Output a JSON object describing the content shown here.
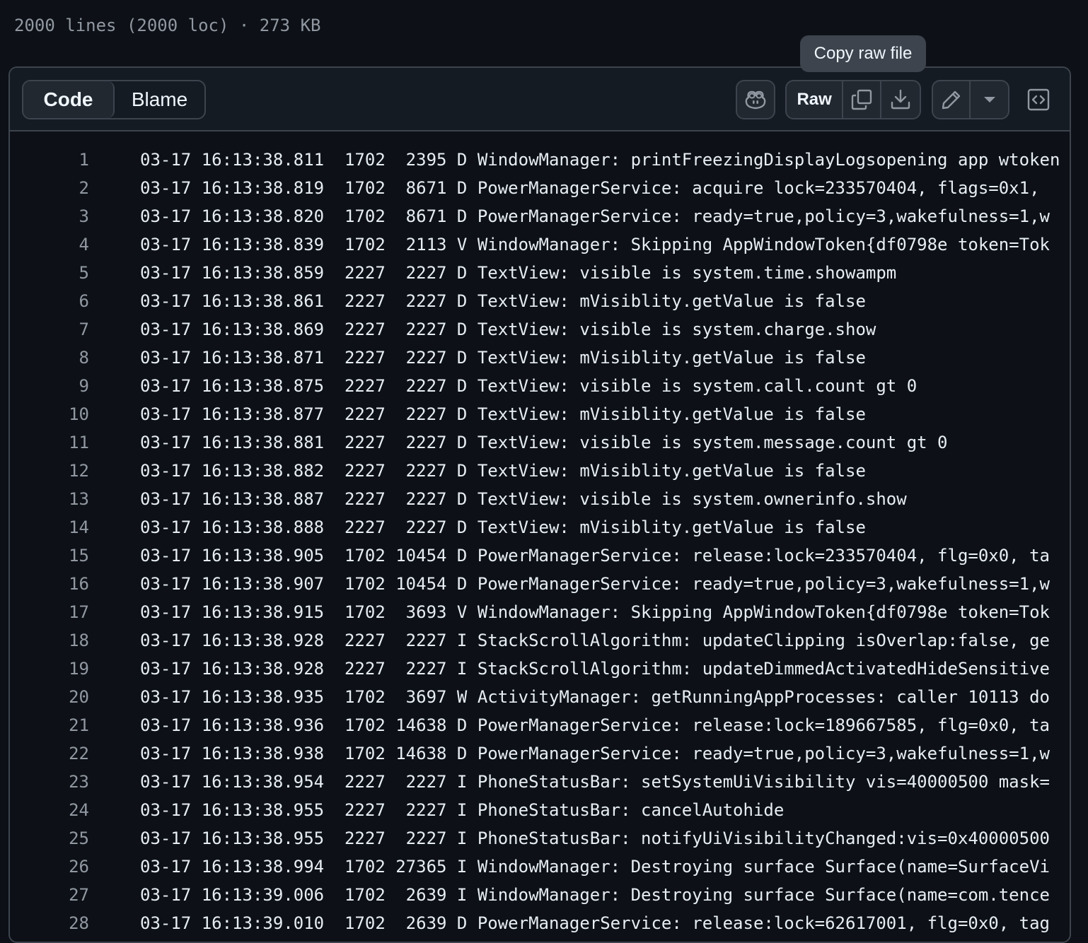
{
  "file_info": "2000 lines (2000 loc) · 273 KB",
  "tooltip": "Copy raw file",
  "toolbar": {
    "tabs": [
      {
        "label": "Code",
        "active": true
      },
      {
        "label": "Blame",
        "active": false
      }
    ],
    "raw_label": "Raw",
    "icons": [
      "copilot-icon",
      "copy-icon",
      "download-icon",
      "pencil-icon",
      "triangle-down-icon",
      "code-square-icon"
    ]
  },
  "lines": [
    {
      "n": "1",
      "t": "03-17 16:13:38.811  1702  2395 D WindowManager: printFreezingDisplayLogsopening app wtoken"
    },
    {
      "n": "2",
      "t": "03-17 16:13:38.819  1702  8671 D PowerManagerService: acquire lock=233570404, flags=0x1, "
    },
    {
      "n": "3",
      "t": "03-17 16:13:38.820  1702  8671 D PowerManagerService: ready=true,policy=3,wakefulness=1,w"
    },
    {
      "n": "4",
      "t": "03-17 16:13:38.839  1702  2113 V WindowManager: Skipping AppWindowToken{df0798e token=Tok"
    },
    {
      "n": "5",
      "t": "03-17 16:13:38.859  2227  2227 D TextView: visible is system.time.showampm"
    },
    {
      "n": "6",
      "t": "03-17 16:13:38.861  2227  2227 D TextView: mVisiblity.getValue is false"
    },
    {
      "n": "7",
      "t": "03-17 16:13:38.869  2227  2227 D TextView: visible is system.charge.show"
    },
    {
      "n": "8",
      "t": "03-17 16:13:38.871  2227  2227 D TextView: mVisiblity.getValue is false"
    },
    {
      "n": "9",
      "t": "03-17 16:13:38.875  2227  2227 D TextView: visible is system.call.count gt 0"
    },
    {
      "n": "10",
      "t": "03-17 16:13:38.877  2227  2227 D TextView: mVisiblity.getValue is false"
    },
    {
      "n": "11",
      "t": "03-17 16:13:38.881  2227  2227 D TextView: visible is system.message.count gt 0"
    },
    {
      "n": "12",
      "t": "03-17 16:13:38.882  2227  2227 D TextView: mVisiblity.getValue is false"
    },
    {
      "n": "13",
      "t": "03-17 16:13:38.887  2227  2227 D TextView: visible is system.ownerinfo.show"
    },
    {
      "n": "14",
      "t": "03-17 16:13:38.888  2227  2227 D TextView: mVisiblity.getValue is false"
    },
    {
      "n": "15",
      "t": "03-17 16:13:38.905  1702 10454 D PowerManagerService: release:lock=233570404, flg=0x0, ta"
    },
    {
      "n": "16",
      "t": "03-17 16:13:38.907  1702 10454 D PowerManagerService: ready=true,policy=3,wakefulness=1,w"
    },
    {
      "n": "17",
      "t": "03-17 16:13:38.915  1702  3693 V WindowManager: Skipping AppWindowToken{df0798e token=Tok"
    },
    {
      "n": "18",
      "t": "03-17 16:13:38.928  2227  2227 I StackScrollAlgorithm: updateClipping isOverlap:false, ge"
    },
    {
      "n": "19",
      "t": "03-17 16:13:38.928  2227  2227 I StackScrollAlgorithm: updateDimmedActivatedHideSensitive"
    },
    {
      "n": "20",
      "t": "03-17 16:13:38.935  1702  3697 W ActivityManager: getRunningAppProcesses: caller 10113 do"
    },
    {
      "n": "21",
      "t": "03-17 16:13:38.936  1702 14638 D PowerManagerService: release:lock=189667585, flg=0x0, ta"
    },
    {
      "n": "22",
      "t": "03-17 16:13:38.938  1702 14638 D PowerManagerService: ready=true,policy=3,wakefulness=1,w"
    },
    {
      "n": "23",
      "t": "03-17 16:13:38.954  2227  2227 I PhoneStatusBar: setSystemUiVisibility vis=40000500 mask="
    },
    {
      "n": "24",
      "t": "03-17 16:13:38.955  2227  2227 I PhoneStatusBar: cancelAutohide"
    },
    {
      "n": "25",
      "t": "03-17 16:13:38.955  2227  2227 I PhoneStatusBar: notifyUiVisibilityChanged:vis=0x40000500"
    },
    {
      "n": "26",
      "t": "03-17 16:13:38.994  1702 27365 I WindowManager: Destroying surface Surface(name=SurfaceVi"
    },
    {
      "n": "27",
      "t": "03-17 16:13:39.006  1702  2639 I WindowManager: Destroying surface Surface(name=com.tence"
    },
    {
      "n": "28",
      "t": "03-17 16:13:39.010  1702  2639 D PowerManagerService: release:lock=62617001, flg=0x0, tag"
    }
  ]
}
